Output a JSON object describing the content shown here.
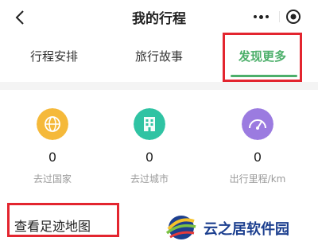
{
  "header": {
    "title": "我的行程"
  },
  "tabs": [
    {
      "label": "行程安排",
      "active": false
    },
    {
      "label": "旅行故事",
      "active": false
    },
    {
      "label": "发现更多",
      "active": true
    }
  ],
  "stats": [
    {
      "value": "0",
      "label": "去过国家",
      "icon": "globe-icon",
      "color": "#f5b93a"
    },
    {
      "value": "0",
      "label": "去过城市",
      "icon": "building-icon",
      "color": "#2fc3a3"
    },
    {
      "value": "0",
      "label": "出行里程/km",
      "icon": "speedometer-icon",
      "color": "#9b7be0"
    }
  ],
  "footprint_link": "查看足迹地图",
  "watermark": {
    "text": "云之居软件园"
  },
  "colors": {
    "accent": "#4caf6a",
    "highlight_box": "#e3252f"
  }
}
